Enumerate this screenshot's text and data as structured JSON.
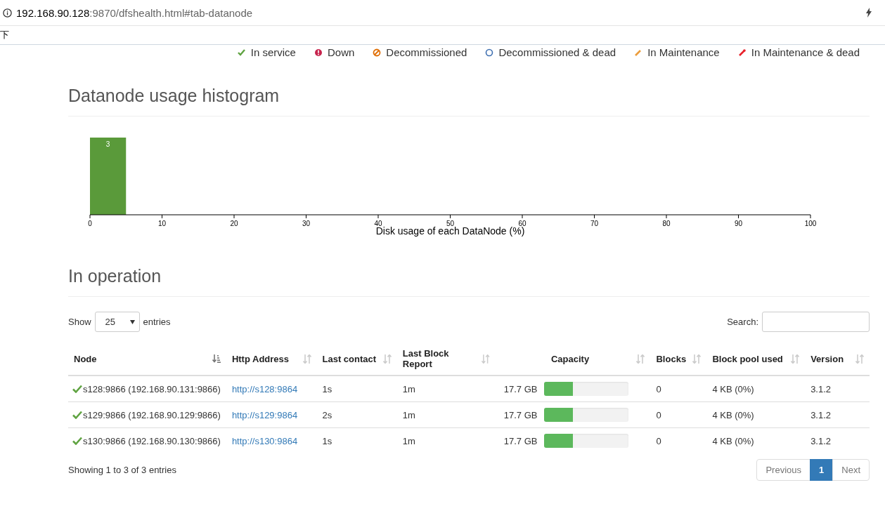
{
  "browser": {
    "url_host": "192.168.90.128",
    "url_rest": ":9870/dfshealth.html#tab-datanode",
    "bookmark": "下"
  },
  "legend": [
    {
      "kind": "in-service",
      "label": "In service",
      "color": "#5fa341"
    },
    {
      "kind": "down",
      "label": "Down",
      "color": "#c7254e"
    },
    {
      "kind": "decommissioned",
      "label": "Decommissioned",
      "color": "#e06d00"
    },
    {
      "kind": "decommissioned-dead",
      "label": "Decommissioned & dead",
      "color": "#3e6fb0"
    },
    {
      "kind": "maintenance",
      "label": "In Maintenance",
      "color": "#eb9d3c"
    },
    {
      "kind": "maintenance-dead",
      "label": "In Maintenance & dead",
      "color": "#e8222b"
    }
  ],
  "histogram": {
    "title": "Datanode usage histogram",
    "chart_data": {
      "type": "bar",
      "xlabel": "Disk usage of each DataNode (%)",
      "x": [
        2.5
      ],
      "values": [
        3
      ],
      "xlim": [
        0,
        100
      ],
      "ylim": [
        0,
        3
      ],
      "xticks": [
        0,
        10,
        20,
        30,
        40,
        50,
        60,
        70,
        80,
        90,
        100
      ],
      "data_labels": true,
      "color": "#5a9a3a"
    }
  },
  "operation": {
    "title": "In operation",
    "show_label": "Show",
    "page_size": "25",
    "entries_label": "entries",
    "search_label": "Search:",
    "columns": [
      {
        "label": "Node",
        "sorted": true
      },
      {
        "label": "Http Address",
        "sorted": false
      },
      {
        "label": "Last contact",
        "sorted": false
      },
      {
        "label": "Last Block Report",
        "sorted": false
      },
      {
        "label": "Capacity",
        "sorted": false
      },
      {
        "label": "Blocks",
        "sorted": false
      },
      {
        "label": "Block pool used",
        "sorted": false
      },
      {
        "label": "Version",
        "sorted": false
      }
    ],
    "rows": [
      {
        "node": "s128:9866 (192.168.90.131:9866)",
        "http": "http://s128:9864",
        "last_contact": "1s",
        "last_block_report": "1m",
        "capacity": "17.7 GB",
        "level": 0.34,
        "blocks": "0",
        "block_pool_used": "4 KB (0%)",
        "version": "3.1.2"
      },
      {
        "node": "s129:9866 (192.168.90.129:9866)",
        "http": "http://s129:9864",
        "last_contact": "2s",
        "last_block_report": "1m",
        "capacity": "17.7 GB",
        "level": 0.34,
        "blocks": "0",
        "block_pool_used": "4 KB (0%)",
        "version": "3.1.2"
      },
      {
        "node": "s130:9866 (192.168.90.130:9866)",
        "http": "http://s130:9864",
        "last_contact": "1s",
        "last_block_report": "1m",
        "capacity": "17.7 GB",
        "level": 0.34,
        "blocks": "0",
        "block_pool_used": "4 KB (0%)",
        "version": "3.1.2"
      }
    ],
    "info": "Showing 1 to 3 of 3 entries",
    "pagination": [
      {
        "label": "Previous",
        "selected": false
      },
      {
        "label": "1",
        "selected": true
      },
      {
        "label": "Next",
        "selected": false
      }
    ]
  }
}
